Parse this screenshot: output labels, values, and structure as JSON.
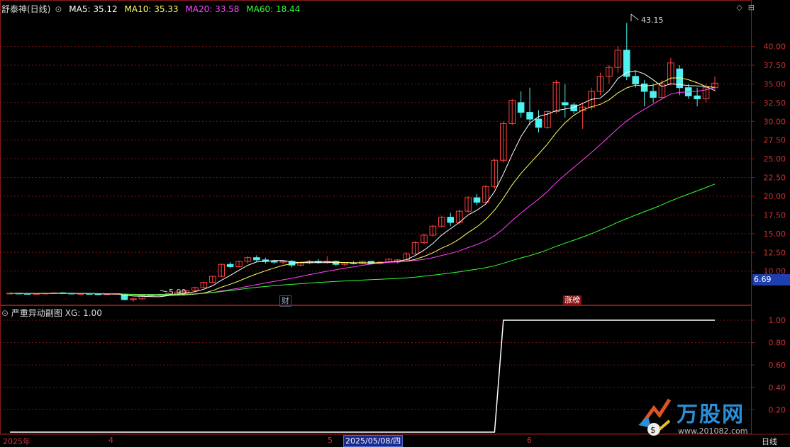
{
  "header": {
    "title": "舒泰神(日线)",
    "ma5": "MA5: 35.12",
    "ma10": "MA10: 35.33",
    "ma20": "MA20: 33.58",
    "ma60": "MA60: 18.44",
    "colors": {
      "ma5": "#ffffff",
      "ma10": "#ffff66",
      "ma20": "#ff44ff",
      "ma60": "#33ff33"
    }
  },
  "subpanel": {
    "title": "严重异动副图",
    "value": "XG: 1.00"
  },
  "annotations": {
    "high": "43.15",
    "low": "5.90",
    "tag_cai": "财",
    "tag_zhangbang": "涨榜"
  },
  "price_badge": "6.69",
  "xaxis": {
    "year_label": "2025年",
    "month4": "4",
    "month5": "5",
    "cursor_date": "2025/05/08/四",
    "month6": "6",
    "period": "日线"
  },
  "brand": {
    "name": "万股网",
    "url": "www.201082.com"
  },
  "chart_data": [
    {
      "type": "candlestick",
      "title": "舒泰神(日线)",
      "yticks": [
        "40.00",
        "37.50",
        "35.00",
        "32.50",
        "30.00",
        "27.50",
        "25.00",
        "22.50",
        "20.00",
        "17.50",
        "15.00",
        "12.50",
        "10.00"
      ],
      "ylim": [
        6.0,
        44.5
      ],
      "grid": true,
      "candles": [
        [
          7.0,
          7.1,
          6.9,
          7.05
        ],
        [
          7.05,
          7.1,
          6.95,
          7.0
        ],
        [
          7.0,
          7.1,
          6.9,
          6.95
        ],
        [
          6.95,
          7.05,
          6.85,
          7.0
        ],
        [
          7.0,
          7.1,
          6.9,
          7.05
        ],
        [
          7.05,
          7.15,
          6.95,
          7.1
        ],
        [
          7.1,
          7.2,
          7.0,
          7.05
        ],
        [
          7.05,
          7.1,
          6.9,
          6.95
        ],
        [
          6.95,
          7.05,
          6.85,
          7.0
        ],
        [
          7.0,
          7.1,
          6.9,
          6.95
        ],
        [
          6.95,
          7.0,
          6.8,
          6.9
        ],
        [
          6.9,
          7.0,
          6.8,
          6.95
        ],
        [
          6.95,
          7.05,
          6.85,
          7.0
        ],
        [
          6.8,
          6.9,
          6.1,
          6.2
        ],
        [
          6.2,
          6.4,
          5.9,
          6.3
        ],
        [
          6.3,
          6.8,
          6.2,
          6.7
        ],
        [
          6.7,
          6.9,
          6.6,
          6.8
        ],
        [
          6.8,
          7.0,
          6.7,
          6.9
        ],
        [
          6.9,
          7.1,
          6.8,
          7.0
        ],
        [
          7.0,
          7.3,
          6.9,
          7.2
        ],
        [
          7.2,
          7.5,
          7.1,
          7.4
        ],
        [
          7.4,
          7.9,
          7.3,
          7.8
        ],
        [
          7.8,
          8.6,
          7.7,
          8.5
        ],
        [
          8.5,
          9.4,
          8.4,
          9.3
        ],
        [
          9.3,
          11.0,
          9.2,
          10.9
        ],
        [
          10.9,
          11.2,
          10.4,
          10.6
        ],
        [
          10.6,
          11.4,
          10.5,
          11.3
        ],
        [
          11.3,
          12.0,
          11.0,
          11.8
        ],
        [
          11.8,
          12.1,
          11.2,
          11.5
        ],
        [
          11.5,
          11.8,
          11.0,
          11.3
        ],
        [
          11.3,
          11.5,
          11.0,
          11.2
        ],
        [
          11.2,
          11.4,
          10.9,
          11.3
        ],
        [
          11.3,
          11.5,
          10.5,
          10.8
        ],
        [
          10.8,
          11.2,
          10.6,
          11.1
        ],
        [
          11.1,
          11.5,
          10.9,
          11.3
        ],
        [
          11.3,
          11.6,
          11.0,
          11.2
        ],
        [
          11.2,
          12.0,
          11.0,
          11.3
        ],
        [
          11.3,
          11.4,
          10.7,
          10.9
        ],
        [
          10.9,
          11.2,
          10.6,
          11.1
        ],
        [
          11.1,
          11.3,
          10.9,
          11.0
        ],
        [
          11.0,
          11.4,
          10.9,
          11.3
        ],
        [
          11.3,
          11.4,
          10.9,
          11.0
        ],
        [
          11.0,
          11.3,
          10.9,
          11.2
        ],
        [
          11.2,
          11.7,
          11.1,
          11.6
        ],
        [
          11.3,
          11.6,
          11.0,
          11.5
        ],
        [
          11.5,
          12.5,
          11.4,
          12.3
        ],
        [
          12.3,
          14.0,
          12.2,
          13.8
        ],
        [
          13.8,
          15.0,
          13.6,
          14.8
        ],
        [
          14.8,
          16.2,
          14.6,
          16.0
        ],
        [
          16.0,
          17.4,
          15.8,
          17.2
        ],
        [
          17.2,
          17.8,
          16.0,
          16.5
        ],
        [
          16.5,
          18.2,
          16.2,
          18.0
        ],
        [
          18.0,
          20.0,
          17.8,
          19.8
        ],
        [
          19.8,
          20.3,
          18.8,
          19.2
        ],
        [
          19.2,
          21.5,
          19.0,
          21.3
        ],
        [
          21.3,
          25.0,
          21.0,
          24.8
        ],
        [
          24.8,
          30.0,
          24.5,
          29.7
        ],
        [
          29.7,
          33.0,
          29.5,
          32.8
        ],
        [
          32.5,
          34.0,
          30.5,
          31.2
        ],
        [
          31.2,
          34.5,
          29.5,
          30.3
        ],
        [
          30.3,
          31.5,
          28.5,
          29.2
        ],
        [
          29.2,
          31.5,
          29.0,
          31.3
        ],
        [
          31.3,
          35.5,
          31.0,
          35.2
        ],
        [
          32.5,
          35.0,
          30.5,
          32.2
        ],
        [
          32.2,
          32.5,
          31.0,
          31.4
        ],
        [
          31.4,
          32.5,
          29.0,
          31.9
        ],
        [
          31.9,
          34.5,
          31.5,
          34.0
        ],
        [
          34.0,
          36.5,
          33.5,
          36.0
        ],
        [
          36.0,
          37.5,
          35.0,
          37.2
        ],
        [
          37.2,
          40.0,
          36.5,
          39.5
        ],
        [
          39.5,
          43.15,
          35.5,
          36.0
        ],
        [
          36.0,
          36.8,
          34.5,
          35.0
        ],
        [
          35.0,
          35.5,
          32.0,
          34.0
        ],
        [
          34.0,
          35.0,
          32.5,
          33.2
        ],
        [
          33.2,
          35.5,
          33.0,
          35.0
        ],
        [
          35.0,
          38.5,
          34.8,
          37.8
        ],
        [
          37.0,
          37.5,
          33.5,
          34.5
        ],
        [
          34.5,
          35.0,
          33.0,
          33.4
        ],
        [
          33.4,
          34.5,
          32.0,
          33.0
        ],
        [
          33.0,
          35.0,
          32.5,
          34.5
        ],
        [
          34.5,
          36.0,
          34.0,
          35.1
        ]
      ]
    },
    {
      "type": "line",
      "title": "严重异动副图",
      "yticks": [
        "1.00",
        "0.80",
        "0.60",
        "0.40",
        "0.20"
      ],
      "ylim": [
        0.0,
        1.0
      ],
      "series": [
        {
          "name": "XG",
          "values": [
            0,
            0,
            0,
            0,
            0,
            0,
            0,
            0,
            0,
            0,
            0,
            0,
            0,
            0,
            0,
            0,
            0,
            0,
            0,
            0,
            0,
            0,
            0,
            0,
            0,
            0,
            0,
            0,
            0,
            0,
            0,
            0,
            0,
            0,
            0,
            0,
            0,
            0,
            0,
            0,
            0,
            0,
            0,
            0,
            0,
            0,
            0,
            0,
            0,
            0,
            0,
            0,
            0,
            0,
            0,
            0,
            1,
            1,
            1,
            1,
            1,
            1,
            1,
            1,
            1,
            1,
            1,
            1,
            1,
            1,
            1,
            1,
            1,
            1,
            1,
            1,
            1,
            1,
            1,
            1,
            1
          ]
        }
      ]
    }
  ]
}
